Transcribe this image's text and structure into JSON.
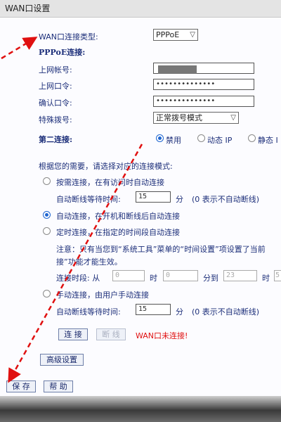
{
  "window": {
    "title": "WAN口设置"
  },
  "form": {
    "conn_type_label": "WAN口连接类型:",
    "conn_type_value": "PPPoE",
    "pppoe_heading": "PPPoE连接:",
    "account_label": "上网帐号:",
    "password_label": "上网口令:",
    "password_value": "••••••••••••••",
    "confirm_label": "确认口令:",
    "confirm_value": "••••••••••••••",
    "dial_label": "特殊拨号:",
    "dial_value": "正常拨号模式"
  },
  "secondary": {
    "label": "第二连接:",
    "options": [
      "禁用",
      "动态 IP",
      "静态 I"
    ],
    "selected": "禁用"
  },
  "modes": {
    "intro": "根据您的需要，请选择对应的连接模式:",
    "on_demand_label": "按需连接，在有访问时自动连接",
    "idle_label": "自动断线等待时间:",
    "idle_value": "15",
    "idle_unit": "分",
    "idle_hint": "(0 表示不自动断线)",
    "auto_label": "自动连接，在开机和断线后自动连接",
    "timed_label": "定时连接，在指定的时间段自动连接",
    "note_line1": "注意：只有当您到“系统工具”菜单的“时间设置”项设置了当前",
    "note_line2": "接”功能才能生效。",
    "period_label": "连接时段: 从",
    "from_hour": "0",
    "hour_unit": "时",
    "from_min": "0",
    "to_label": "分到",
    "to_hour": "23",
    "to_hour_unit": "时",
    "to_min": "5",
    "manual_label": "手动连接，由用户手动连接",
    "idle2_label": "自动断线等待时间:",
    "idle2_value": "15",
    "idle2_unit": "分",
    "idle2_hint": "(0 表示不自动断线)",
    "selected_mode": "auto"
  },
  "actions": {
    "connect": "连 接",
    "disconnect": "断 线",
    "status": "WAN口未连接!",
    "advanced": "高级设置",
    "save": "保 存",
    "help": "帮 助"
  },
  "colors": {
    "label_blue": "#1d2f7a",
    "status_red": "#e01010",
    "annotation_red": "#e01010",
    "radio_blue": "#1f66d1"
  }
}
